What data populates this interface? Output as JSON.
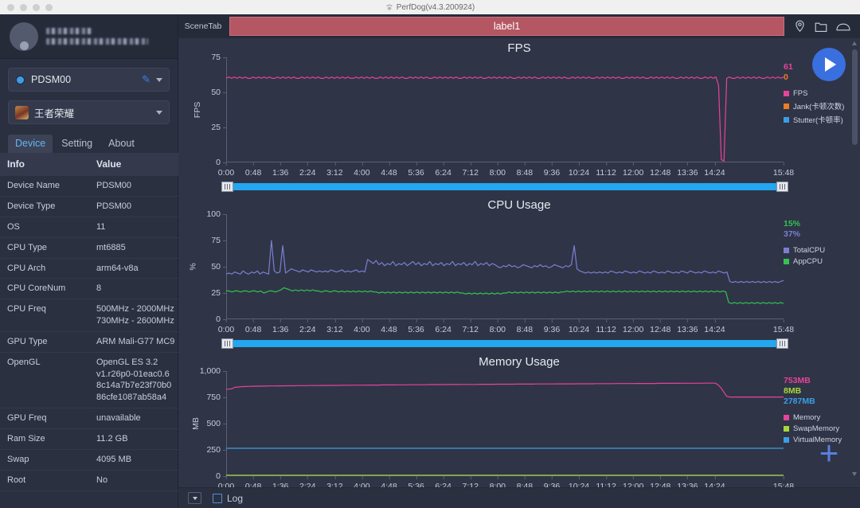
{
  "window": {
    "title": "PerfDog(v4.3.200924)",
    "app_icon": "paw-icon"
  },
  "sidebar": {
    "user": {
      "name_masked": "",
      "email_masked": ""
    },
    "device_selector": {
      "value": "PDSM00",
      "icon": "android-icon",
      "edit_icon": "pen-icon",
      "chevron": "chevron-down-icon"
    },
    "app_selector": {
      "value": "王者荣耀",
      "icon": "game-icon",
      "chevron": "chevron-down-icon"
    },
    "tabs": [
      {
        "label": "Device",
        "active": true
      },
      {
        "label": "Setting",
        "active": false
      },
      {
        "label": "About",
        "active": false
      }
    ],
    "table": {
      "headers": [
        "Info",
        "Value"
      ],
      "rows": [
        {
          "info": "Device Name",
          "value": "PDSM00"
        },
        {
          "info": "Device Type",
          "value": "PDSM00"
        },
        {
          "info": "OS",
          "value": "11"
        },
        {
          "info": "CPU Type",
          "value": "mt6885"
        },
        {
          "info": "CPU Arch",
          "value": "arm64-v8a"
        },
        {
          "info": "CPU CoreNum",
          "value": "8"
        },
        {
          "info": "CPU Freq",
          "value": "500MHz - 2000MHz\n730MHz - 2600MHz"
        },
        {
          "info": "GPU Type",
          "value": "ARM Mali-G77 MC9"
        },
        {
          "info": "OpenGL",
          "value": "OpenGL ES 3.2\nv1.r26p0-01eac0.6\n8c14a7b7e23f70b0\n86cfe1087ab58a4"
        },
        {
          "info": "GPU Freq",
          "value": "unavailable"
        },
        {
          "info": "Ram Size",
          "value": "11.2 GB"
        },
        {
          "info": "Swap",
          "value": "4095 MB"
        },
        {
          "info": "Root",
          "value": "No"
        }
      ]
    }
  },
  "scenebar": {
    "scene_tab_label": "SceneTab",
    "label_value": "label1",
    "icons": [
      "location-pin-icon",
      "folder-icon",
      "cloud-icon"
    ]
  },
  "controls": {
    "play_button": "play-icon",
    "add_button": "plus-icon",
    "log_checkbox_label": "Log",
    "dropdown_button": "chevron-down-icon"
  },
  "colors": {
    "fps": "#e8429b",
    "jank": "#ef7b22",
    "stutter": "#3b9de8",
    "appcpu": "#35c155",
    "totalcpu": "#7b7fd4",
    "memory": "#e8429b",
    "swapmemory": "#a8d83a",
    "virtualmemory": "#3b9de8",
    "label_bar": "#b55663",
    "accent": "#3a6fe0",
    "scrub_track": "#22a7f0"
  },
  "chart_data": [
    {
      "type": "line",
      "title": "FPS",
      "ylabel": "FPS",
      "xlabel": "",
      "ylim": [
        0,
        75
      ],
      "yticks": [
        0,
        25,
        50,
        75
      ],
      "xticks": [
        "0:00",
        "0:48",
        "1:36",
        "2:24",
        "3:12",
        "4:00",
        "4:48",
        "5:36",
        "6:24",
        "7:12",
        "8:00",
        "8:48",
        "9:36",
        "10:24",
        "11:12",
        "12:00",
        "12:48",
        "13:36",
        "14:24",
        "15:48"
      ],
      "grid": false,
      "legend_position": "right",
      "current_values": [
        {
          "name": "FPS",
          "value": "61",
          "color": "#e8429b"
        },
        {
          "name": "Jank(卡顿次数)",
          "value": "0",
          "color": "#ef7b22"
        }
      ],
      "series": [
        {
          "name": "FPS",
          "color": "#e8429b",
          "values": [
            60,
            61,
            60,
            61,
            60,
            61,
            60,
            61,
            60,
            60,
            61,
            60,
            61,
            60,
            61,
            60,
            61,
            60,
            60,
            61,
            60,
            61,
            60,
            61,
            60,
            61,
            60,
            60,
            61,
            60,
            61,
            60,
            61,
            60,
            61,
            60,
            60,
            61,
            60,
            61,
            60,
            61,
            60,
            61,
            60,
            61,
            60,
            60,
            61,
            60,
            61,
            60,
            61,
            60,
            61,
            60,
            60,
            61,
            60,
            61,
            60,
            61,
            60,
            61,
            60,
            61,
            60,
            60,
            61,
            60,
            61,
            60,
            61,
            60,
            61,
            60,
            60,
            61,
            60,
            61,
            60,
            61,
            60,
            61,
            60,
            61,
            60,
            60,
            61,
            60,
            61,
            60,
            61,
            60,
            61,
            60,
            60,
            61,
            60,
            61,
            60,
            61,
            60,
            61,
            60,
            61,
            60,
            60,
            61,
            60,
            61,
            60,
            61,
            60,
            61,
            60,
            60,
            61,
            60,
            61,
            60,
            61,
            60,
            61,
            60,
            61,
            60,
            60,
            61,
            60,
            61,
            60,
            61,
            60,
            61,
            60,
            60,
            61,
            60,
            61,
            60,
            61,
            60,
            61,
            60,
            61,
            60,
            60,
            61,
            60,
            61,
            60,
            61,
            60,
            61,
            60,
            60,
            61,
            60,
            61,
            60,
            61,
            60,
            61,
            60,
            61,
            60,
            60,
            61,
            60,
            61,
            60,
            61,
            60,
            61,
            60,
            60,
            61,
            60,
            61,
            60,
            61,
            55,
            2,
            1,
            60,
            61,
            60,
            60,
            61,
            60,
            61,
            60,
            61,
            60,
            61,
            60,
            61,
            60,
            60,
            61,
            60,
            61,
            60,
            61,
            60,
            61
          ]
        },
        {
          "name": "Jank(卡顿次数)",
          "color": "#ef7b22",
          "values": []
        },
        {
          "name": "Stutter(卡顿率)",
          "color": "#3b9de8",
          "values": []
        }
      ]
    },
    {
      "type": "line",
      "title": "CPU Usage",
      "ylabel": "%",
      "xlabel": "",
      "ylim": [
        0,
        100
      ],
      "yticks": [
        0,
        25,
        50,
        75,
        100
      ],
      "xticks": [
        "0:00",
        "0:48",
        "1:36",
        "2:24",
        "3:12",
        "4:00",
        "4:48",
        "5:36",
        "6:24",
        "7:12",
        "8:00",
        "8:48",
        "9:36",
        "10:24",
        "11:12",
        "12:00",
        "12:48",
        "13:36",
        "14:24",
        "15:48"
      ],
      "grid": false,
      "legend_position": "right",
      "current_values": [
        {
          "name": "AppCPU",
          "value": "15%",
          "color": "#35c155"
        },
        {
          "name": "TotalCPU",
          "value": "37%",
          "color": "#7b7fd4"
        }
      ],
      "series": [
        {
          "name": "TotalCPU",
          "color": "#7b7fd4",
          "values": [
            43,
            44,
            43,
            45,
            44,
            43,
            46,
            44,
            43,
            45,
            44,
            46,
            43,
            45,
            44,
            43,
            75,
            46,
            44,
            45,
            70,
            44,
            46,
            48,
            47,
            46,
            45,
            47,
            46,
            45,
            47,
            46,
            45,
            46,
            45,
            46,
            45,
            47,
            46,
            45,
            46,
            47,
            45,
            46,
            45,
            46,
            47,
            45,
            46,
            45,
            57,
            55,
            53,
            56,
            52,
            54,
            51,
            53,
            52,
            55,
            51,
            53,
            52,
            54,
            51,
            53,
            55,
            52,
            54,
            51,
            53,
            52,
            55,
            51,
            53,
            52,
            54,
            51,
            53,
            52,
            55,
            51,
            53,
            52,
            54,
            51,
            53,
            52,
            55,
            51,
            53,
            52,
            54,
            51,
            53,
            52,
            50,
            49,
            51,
            50,
            52,
            50,
            51,
            49,
            50,
            52,
            51,
            50,
            49,
            51,
            50,
            52,
            50,
            51,
            49,
            50,
            52,
            51,
            50,
            49,
            51,
            50,
            52,
            70,
            48,
            46,
            45,
            44,
            45,
            44,
            45,
            44,
            45,
            44,
            45,
            44,
            46,
            45,
            44,
            45,
            44,
            46,
            45,
            44,
            45,
            44,
            46,
            45,
            44,
            45,
            44,
            46,
            45,
            44,
            45,
            44,
            46,
            45,
            44,
            45,
            44,
            46,
            45,
            44,
            46,
            45,
            44,
            45,
            44,
            46,
            45,
            44,
            45,
            44,
            46,
            45,
            44,
            45,
            36,
            35,
            36,
            35,
            36,
            35,
            36,
            35,
            36,
            35,
            36,
            35,
            36,
            35,
            36,
            35,
            36,
            35,
            36,
            37
          ]
        },
        {
          "name": "AppCPU",
          "color": "#35c155",
          "values": [
            27,
            27,
            26,
            27,
            27,
            26,
            27,
            27,
            26,
            27,
            27,
            26,
            27,
            25,
            26,
            27,
            27,
            26,
            27,
            28,
            30,
            29,
            28,
            27,
            28,
            27,
            28,
            27,
            28,
            27,
            28,
            27,
            27,
            26,
            27,
            27,
            26,
            27,
            27,
            26,
            27,
            26,
            27,
            26,
            27,
            26,
            27,
            26,
            27,
            26,
            27,
            26,
            26,
            25,
            26,
            25,
            26,
            25,
            26,
            25,
            26,
            25,
            26,
            25,
            26,
            25,
            26,
            25,
            26,
            25,
            26,
            25,
            26,
            25,
            26,
            25,
            26,
            25,
            26,
            25,
            26,
            25,
            25,
            24,
            25,
            24,
            25,
            24,
            25,
            24,
            25,
            24,
            25,
            24,
            25,
            24,
            25,
            25,
            26,
            25,
            26,
            25,
            26,
            25,
            26,
            25,
            26,
            25,
            26,
            25,
            26,
            25,
            26,
            25,
            26,
            25,
            26,
            26,
            27,
            26,
            27,
            26,
            27,
            26,
            27,
            26,
            27,
            26,
            27,
            26,
            27,
            26,
            27,
            26,
            27,
            26,
            27,
            26,
            27,
            26,
            27,
            26,
            27,
            26,
            27,
            26,
            27,
            26,
            27,
            26,
            27,
            26,
            27,
            26,
            27,
            26,
            27,
            26,
            27,
            26,
            27,
            26,
            27,
            26,
            27,
            26,
            27,
            26,
            27,
            26,
            27,
            26,
            27,
            26,
            16,
            15,
            16,
            15,
            16,
            15,
            16,
            15,
            16,
            15,
            16,
            15,
            16,
            15,
            16,
            15,
            16,
            15,
            16,
            15
          ]
        }
      ]
    },
    {
      "type": "line",
      "title": "Memory Usage",
      "ylabel": "MB",
      "xlabel": "",
      "ylim": [
        0,
        1000
      ],
      "yticks": [
        0,
        250,
        500,
        750,
        1000
      ],
      "ytick_labels": [
        "0",
        "250",
        "500",
        "750",
        "1,000"
      ],
      "xticks": [
        "0:00",
        "0:48",
        "1:36",
        "2:24",
        "3:12",
        "4:00",
        "4:48",
        "5:36",
        "6:24",
        "7:12",
        "8:00",
        "8:48",
        "9:36",
        "10:24",
        "11:12",
        "12:00",
        "12:48",
        "13:36",
        "14:24",
        "15:48"
      ],
      "grid": false,
      "legend_position": "right",
      "current_values": [
        {
          "name": "Memory",
          "value": "753MB",
          "color": "#e8429b"
        },
        {
          "name": "SwapMemory",
          "value": "8MB",
          "color": "#a8d83a"
        },
        {
          "name": "VirtualMemory",
          "value": "2787MB",
          "color": "#3b9de8"
        }
      ],
      "series": [
        {
          "name": "Memory",
          "color": "#e8429b",
          "values": [
            828,
            828,
            830,
            845,
            848,
            850,
            852,
            853,
            854,
            855,
            855,
            856,
            856,
            857,
            857,
            858,
            858,
            858,
            859,
            859,
            859,
            860,
            860,
            860,
            860,
            861,
            861,
            861,
            861,
            862,
            862,
            862,
            862,
            863,
            863,
            863,
            863,
            864,
            864,
            864,
            864,
            865,
            865,
            865,
            865,
            866,
            866,
            866,
            866,
            866,
            867,
            867,
            867,
            867,
            867,
            868,
            868,
            868,
            868,
            868,
            869,
            869,
            869,
            869,
            869,
            870,
            870,
            870,
            870,
            870,
            870,
            871,
            871,
            871,
            871,
            871,
            871,
            872,
            872,
            872,
            872,
            872,
            872,
            873,
            873,
            873,
            873,
            873,
            873,
            874,
            874,
            874,
            874,
            874,
            874,
            875,
            875,
            875,
            875,
            875,
            875,
            875,
            876,
            876,
            876,
            876,
            876,
            876,
            876,
            877,
            877,
            877,
            877,
            877,
            877,
            877,
            878,
            878,
            878,
            878,
            878,
            878,
            878,
            879,
            879,
            879,
            879,
            879,
            879,
            879,
            880,
            880,
            880,
            880,
            880,
            880,
            880,
            881,
            881,
            881,
            881,
            881,
            881,
            881,
            882,
            882,
            882,
            882,
            882,
            882,
            882,
            882,
            883,
            883,
            883,
            883,
            883,
            883,
            883,
            883,
            884,
            884,
            884,
            884,
            884,
            884,
            884,
            884,
            885,
            885,
            885,
            885,
            885,
            868,
            840,
            800,
            760,
            753,
            753,
            753,
            753,
            753,
            753,
            753,
            753,
            753,
            753,
            753,
            753,
            753,
            753,
            753,
            753,
            753,
            753,
            753,
            753
          ]
        },
        {
          "name": "SwapMemory",
          "color": "#a8d83a",
          "values": [
            8,
            8,
            8,
            8,
            8,
            8,
            8,
            8,
            8,
            8,
            8,
            8,
            8,
            8,
            8,
            8,
            8,
            8,
            8,
            8
          ]
        },
        {
          "name": "VirtualMemory",
          "color": "#3b9de8",
          "values": [
            265,
            265,
            265,
            265,
            265,
            265,
            265,
            265,
            265,
            265,
            265,
            265,
            265,
            265,
            265,
            265,
            265,
            265,
            265,
            265
          ]
        }
      ]
    }
  ]
}
